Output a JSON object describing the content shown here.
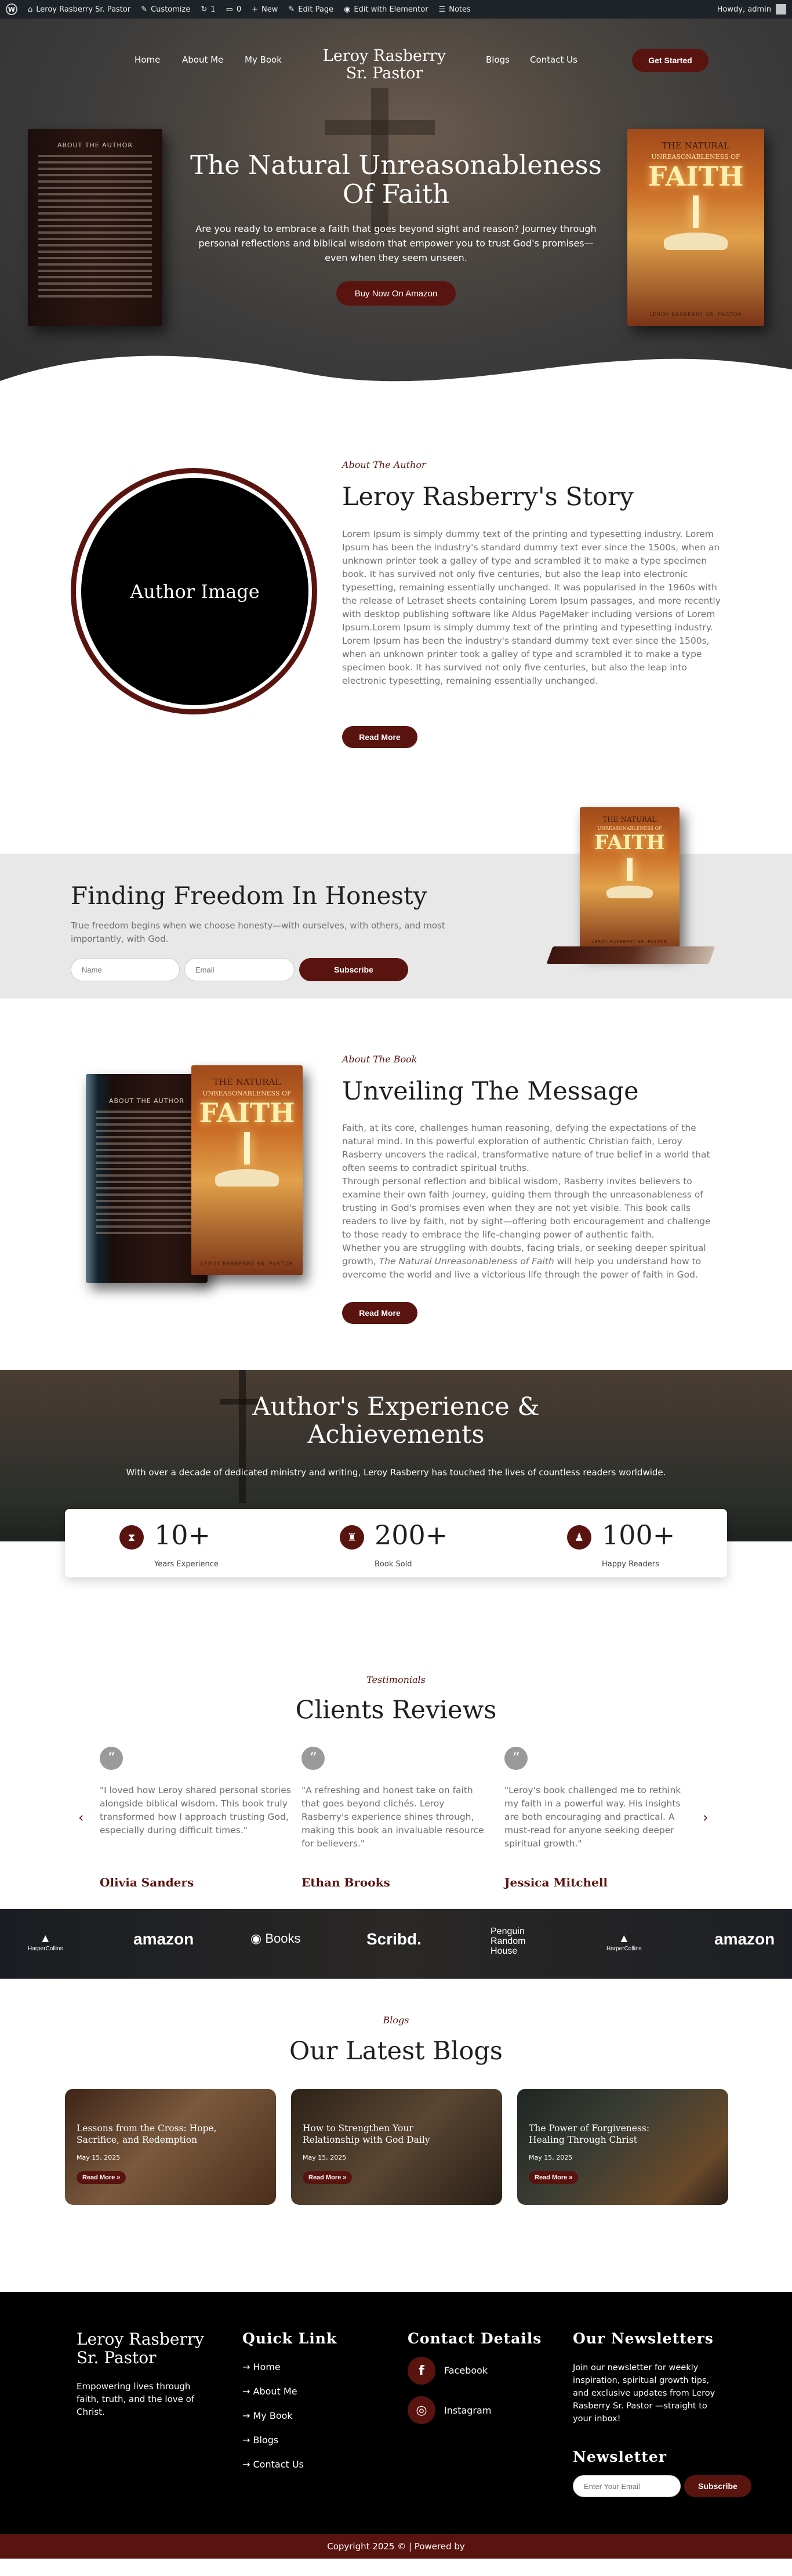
{
  "colors": {
    "primary": "#5a1410",
    "admin_bar": "#1d2327",
    "band_gray": "#e8e8e8"
  },
  "admin_bar": {
    "site_name": "Leroy Rasberry Sr. Pastor",
    "customize": "Customize",
    "updates": "1",
    "comments": "0",
    "new": "New",
    "edit_page": "Edit Page",
    "edit_elementor": "Edit with Elementor",
    "notes": "Notes",
    "howdy": "Howdy, admin"
  },
  "nav": {
    "logo": "Leroy Rasberry Sr. Pastor",
    "items": [
      "Home",
      "About Me",
      "My Book",
      "Blogs",
      "Contact Us"
    ],
    "cta": "Get Started"
  },
  "hero": {
    "title": "The Natural Unreasonableness Of Faith",
    "text": "Are you ready to embrace a faith that goes beyond sight and reason? Journey through personal reflections and biblical wisdom that empower you to trust God's promises—even when they seem unseen.",
    "button": "Buy Now On Amazon"
  },
  "book": {
    "back_title": "ABOUT THE AUTHOR",
    "front_the": "THE NATURAL",
    "front_sub": "UNREASONABLENESS OF",
    "front_faith": "FAITH",
    "author": "LEROY RASBERRY SR. PASTOR"
  },
  "about": {
    "eyebrow": "About The Author",
    "title": "Leroy Rasberry's Story",
    "image_label": "Author Image",
    "text": "Lorem Ipsum is simply dummy text of the printing and typesetting industry. Lorem Ipsum has been the industry's standard dummy text ever since the 1500s, when an unknown printer took a galley of type and scrambled it to make a type specimen book. It has survived not only five centuries, but also the leap into electronic typesetting, remaining essentially unchanged. It was popularised in the 1960s with the release of Letraset sheets containing Lorem Ipsum passages, and more recently with desktop publishing software like Aldus PageMaker including versions of Lorem Ipsum.Lorem Ipsum is simply dummy text of the printing and typesetting industry. Lorem Ipsum has been the industry's standard dummy text ever since the 1500s, when an unknown printer took a galley of type and scrambled it to make a type specimen book. It has survived not only five centuries, but also the leap into electronic typesetting, remaining essentially unchanged.",
    "button": "Read More"
  },
  "freedom": {
    "title": "Finding Freedom In Honesty",
    "text": "True freedom begins when we choose honesty—with ourselves, with others, and most importantly, with God.",
    "name_placeholder": "Name",
    "email_placeholder": "Email",
    "button": "Subscribe"
  },
  "message": {
    "eyebrow": "About The Book",
    "title": "Unveiling The Message",
    "p1": "Faith, at its core, challenges human reasoning, defying the expectations of the natural mind. In this powerful exploration of authentic Christian faith, Leroy Rasberry uncovers the radical, transformative nature of true belief in a world that often seems to contradict spiritual truths.",
    "p2": "Through personal reflection and biblical wisdom, Rasberry invites believers to examine their own faith journey, guiding them through the unreasonableness of trusting in God's promises even when they are not yet visible. This book calls readers to live by faith, not by sight—offering both encouragement and challenge to those ready to embrace the life-changing power of authentic faith.",
    "p3_pre": "Whether you are struggling with doubts, facing trials, or seeking deeper spiritual growth, ",
    "p3_em": "The Natural Unreasonableness of Faith",
    "p3_post": " will help you understand how to overcome the world and live a victorious life through the power of faith in God.",
    "button": "Read More"
  },
  "experience": {
    "title": "Author's Experience & Achievements",
    "text": "With over a decade of dedicated ministry and writing, Leroy Rasberry has touched the lives of countless readers worldwide.",
    "stats": [
      {
        "num": "10+",
        "label": "Years Experience",
        "icon": "hourglass-icon"
      },
      {
        "num": "200+",
        "label": "Book Sold",
        "icon": "trophy-icon"
      },
      {
        "num": "100+",
        "label": "Happy Readers",
        "icon": "person-icon"
      }
    ]
  },
  "testimonials": {
    "eyebrow": "Testimonials",
    "title": "Clients Reviews",
    "items": [
      {
        "text": "\"I loved how Leroy shared personal stories alongside biblical wisdom. This book truly transformed how I approach trusting God, especially during difficult times.\"",
        "name": "Olivia Sanders"
      },
      {
        "text": "\"A refreshing and honest take on faith that goes beyond clichés. Leroy Rasberry's experience shines through, making this book an invaluable resource for believers.\"",
        "name": "Ethan Brooks"
      },
      {
        "text": "\"Leroy's book challenged me to rethink my faith in a powerful way. His insights are both encouraging and practical. A must-read for anyone seeking deeper spiritual growth.\"",
        "name": "Jessica Mitchell"
      }
    ]
  },
  "logos": [
    "HarperCollins",
    "amazon",
    "Books",
    "Scribd.",
    "Penguin Random House",
    "HarperCollins",
    "amazon"
  ],
  "blogs": {
    "eyebrow": "Blogs",
    "title": "Our Latest Blogs",
    "items": [
      {
        "title": "Lessons from the Cross: Hope, Sacrifice, and Redemption",
        "date": "May 15, 2025",
        "button": "Read More »"
      },
      {
        "title": "How to Strengthen Your Relationship with God Daily",
        "date": "May 15, 2025",
        "button": "Read More »"
      },
      {
        "title": "The Power of Forgiveness: Healing Through Christ",
        "date": "May 15, 2025",
        "button": "Read More »"
      }
    ]
  },
  "footer": {
    "brand": "Leroy Rasberry Sr. Pastor",
    "tagline": "Empowering lives through faith, truth, and the love of Christ.",
    "quick_title": "Quick Link",
    "quick_links": [
      "Home",
      "About Me",
      "My Book",
      "Blogs",
      "Contact Us"
    ],
    "contact_title": "Contact Details",
    "facebook": "Facebook",
    "instagram": "Instagram",
    "news_title": "Our Newsletters",
    "news_text": "Join our newsletter for weekly inspiration, spiritual growth tips, and exclusive updates from Leroy Rasberry Sr. Pastor —straight to your inbox!",
    "news2_title": "Newsletter",
    "email_placeholder": "Enter Your Email",
    "subscribe": "Subscribe",
    "copyright": "Copyright 2025 © | Powered by"
  }
}
